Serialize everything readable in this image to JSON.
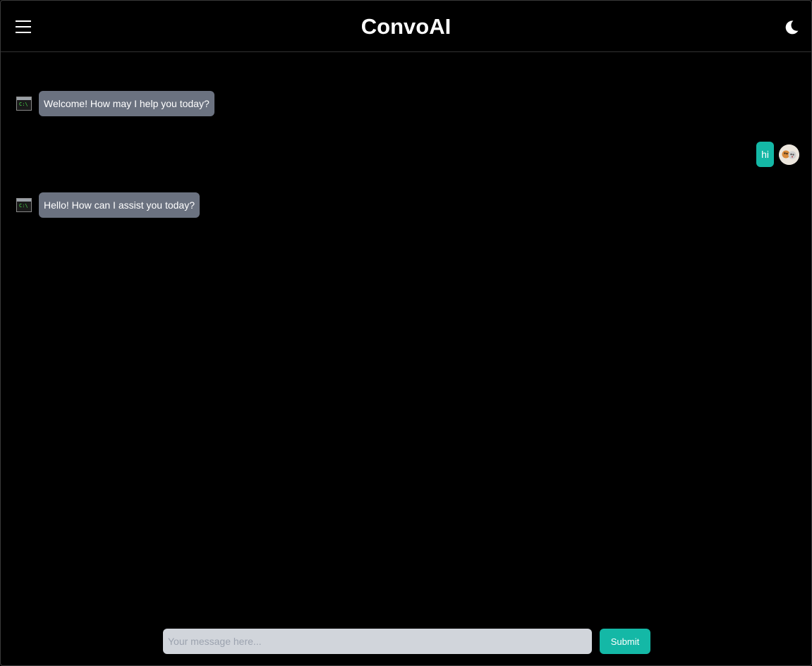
{
  "header": {
    "title": "ConvoAI",
    "menu_icon": "hamburger-menu-icon",
    "theme_icon": "moon-icon"
  },
  "messages": [
    {
      "role": "bot",
      "text": "Welcome! How may I help you today?",
      "avatar_icon": "terminal-icon",
      "avatar_text": "C:\\"
    },
    {
      "role": "user",
      "text": "hi",
      "avatar_icon": "user-avatar-icon"
    },
    {
      "role": "bot",
      "text": "Hello! How can I assist you today?",
      "avatar_icon": "terminal-icon",
      "avatar_text": "C:\\"
    }
  ],
  "composer": {
    "placeholder": "Your message here...",
    "value": "",
    "submit_label": "Submit"
  },
  "colors": {
    "background": "#000000",
    "bot_bubble": "#6b7280",
    "user_bubble": "#14b8a6",
    "accent": "#14b8a6",
    "input_background": "#d1d5db"
  }
}
